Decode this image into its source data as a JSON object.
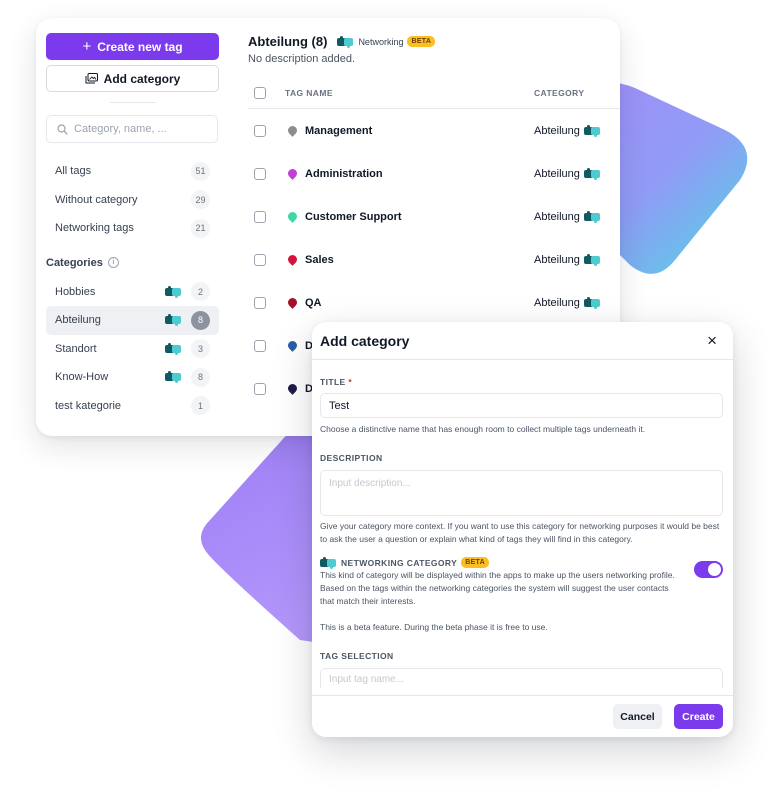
{
  "sidebar": {
    "create_tag_label": "Create new tag",
    "add_category_label": "Add category",
    "search_placeholder": "Category, name, ...",
    "filters": [
      {
        "label": "All tags",
        "count": "51"
      },
      {
        "label": "Without category",
        "count": "29"
      },
      {
        "label": "Networking tags",
        "count": "21"
      }
    ],
    "categories_heading": "Categories",
    "categories": [
      {
        "label": "Hobbies",
        "count": "2",
        "networking": true,
        "active": false
      },
      {
        "label": "Abteilung",
        "count": "8",
        "networking": true,
        "active": true
      },
      {
        "label": "Standort",
        "count": "3",
        "networking": true,
        "active": false
      },
      {
        "label": "Know-How",
        "count": "8",
        "networking": true,
        "active": false
      },
      {
        "label": "test kategorie",
        "count": "1",
        "networking": false,
        "active": false
      }
    ]
  },
  "content": {
    "title": "Abteilung (8)",
    "networking_label": "Networking",
    "beta_label": "BETA",
    "description": "No description added.",
    "columns": {
      "name": "TAG NAME",
      "category": "CATEGORY"
    },
    "rows": [
      {
        "name": "Management",
        "category": "Abteilung",
        "color": "#8d8d8d"
      },
      {
        "name": "Administration",
        "category": "Abteilung",
        "color": "#c23fd6"
      },
      {
        "name": "Customer Support",
        "category": "Abteilung",
        "color": "#3fd6a6"
      },
      {
        "name": "Sales",
        "category": "Abteilung",
        "color": "#d6143b"
      },
      {
        "name": "QA",
        "category": "Abteilung",
        "color": "#a3102a"
      },
      {
        "name": "D",
        "category": "",
        "color": "#2a5ca8"
      },
      {
        "name": "D",
        "category": "",
        "color": "#1e1b4b"
      }
    ]
  },
  "modal": {
    "title": "Add category",
    "close_icon": "×",
    "title_label": "TITLE",
    "required_mark": "*",
    "title_value": "Test",
    "title_hint": "Choose a distinctive name that has enough room to collect multiple tags underneath it.",
    "description_label": "DESCRIPTION",
    "description_placeholder": "Input description...",
    "description_hint": "Give your category more context. If you want to use this category for networking purposes it would be best to ask the user a question or explain what kind of tags they will find in this category.",
    "networking_label": "NETWORKING CATEGORY",
    "beta_label": "BETA",
    "networking_enabled": true,
    "networking_text": "This kind of category will be displayed within the apps to make up the users networking profile. Based on the tags within the networking categories the system will suggest the user contacts that match their interests.",
    "beta_note": "This is a beta feature. During the beta phase it is free to use.",
    "tag_selection_label": "TAG SELECTION",
    "tag_placeholder": "Input tag name...",
    "cancel_label": "Cancel",
    "create_label": "Create"
  },
  "colors": {
    "accent": "#7c3aed",
    "beta": "#fbbf24",
    "puzzle_dark": "#0f5a63",
    "puzzle_light": "#4ecbd0"
  }
}
